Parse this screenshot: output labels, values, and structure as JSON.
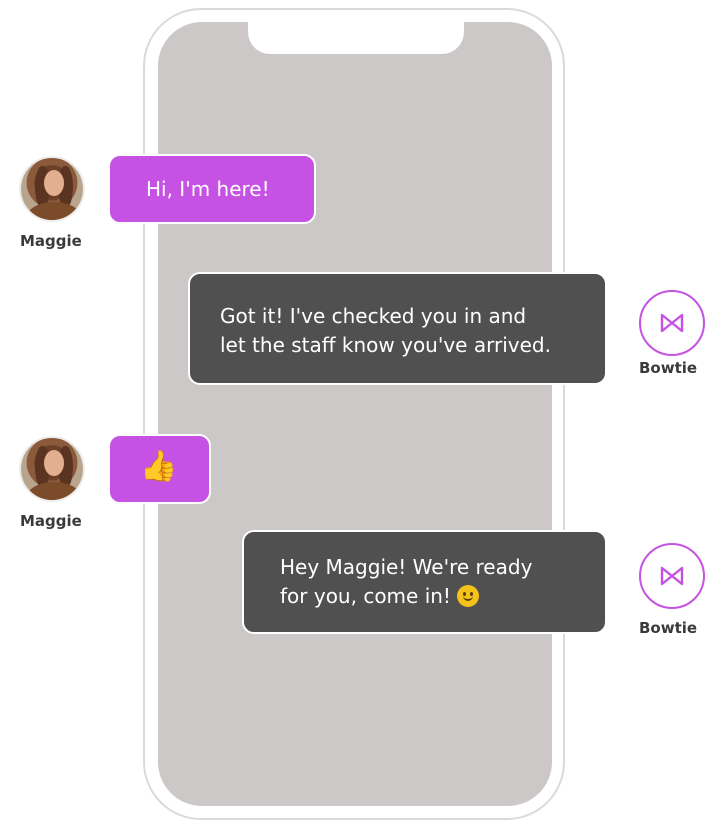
{
  "phone": {
    "screen_color": "#cdc8c8"
  },
  "colors": {
    "user_bubble": "#c552e2",
    "bot_bubble": "#505050",
    "bot_avatar_ring": "#c552e2"
  },
  "messages": [
    {
      "sender": "Maggie",
      "role": "user",
      "lines": [
        "Hi, I'm here!"
      ],
      "avatar_icon": "user-photo-icon"
    },
    {
      "sender": "Bowtie",
      "role": "bot",
      "lines": [
        "Got it! I've checked you in and",
        "let the staff know you've arrived."
      ],
      "avatar_icon": "bowtie-icon"
    },
    {
      "sender": "Maggie",
      "role": "user",
      "emoji": "👍",
      "avatar_icon": "user-photo-icon"
    },
    {
      "sender": "Bowtie",
      "role": "bot",
      "lines": [
        "Hey Maggie! We're ready",
        "for you, come in!"
      ],
      "trailing_emoji_icon": "smiley-icon",
      "avatar_icon": "bowtie-icon"
    }
  ]
}
